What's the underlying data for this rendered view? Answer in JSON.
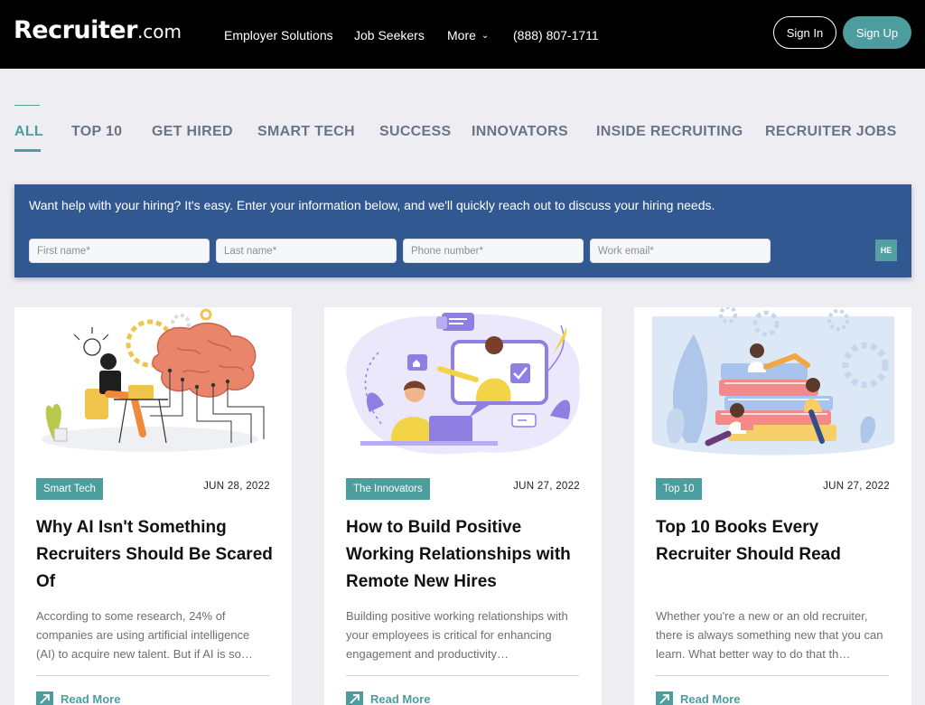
{
  "header": {
    "logo_main": "Recruiter",
    "logo_suffix": ".com",
    "nav": {
      "employer": "Employer Solutions",
      "seekers": "Job Seekers",
      "more": "More",
      "phone": "(888) 807-1711"
    },
    "sign_in": "Sign In",
    "sign_up": "Sign Up"
  },
  "tabs": [
    "ALL",
    "TOP 10",
    "GET HIRED",
    "SMART TECH",
    "SUCCESS",
    "INNOVATORS",
    "INSIDE RECRUITING",
    "RECRUITER JOBS"
  ],
  "active_tab": "ALL",
  "hire_form": {
    "text": "Want help with your hiring? It's easy. Enter your information below, and we'll quickly reach out to discuss your hiring needs.",
    "placeholders": {
      "first": "First name*",
      "last": "Last name*",
      "phone": "Phone number*",
      "email": "Work email*"
    },
    "badge": "HE"
  },
  "cards": [
    {
      "tag": "Smart Tech",
      "date": "JUN 28, 2022",
      "title": "Why AI Isn't Something Recruiters Should Be Scared Of",
      "excerpt": "According to some research, 24% of companies are using artificial intelligence (AI) to acquire new talent. But if AI is so…",
      "read_more": "Read More"
    },
    {
      "tag": "The Innovators",
      "date": "JUN 27, 2022",
      "title": "How to Build Positive Working Relationships with Remote New Hires",
      "excerpt": "Building positive working relationships with your employees is critical for enhancing engagement and productivity…",
      "read_more": "Read More"
    },
    {
      "tag": "Top 10",
      "date": "JUN 27, 2022",
      "title": "Top 10 Books Every Recruiter Should Read",
      "excerpt": "Whether you're a new or an old recruiter, there is always something new that you can learn. What better way to do that th…",
      "read_more": "Read More"
    }
  ],
  "colors": {
    "accent": "#4d9d9e",
    "header_bg": "#000000",
    "form_bg": "#315891",
    "page_bg": "#eeeef2"
  }
}
